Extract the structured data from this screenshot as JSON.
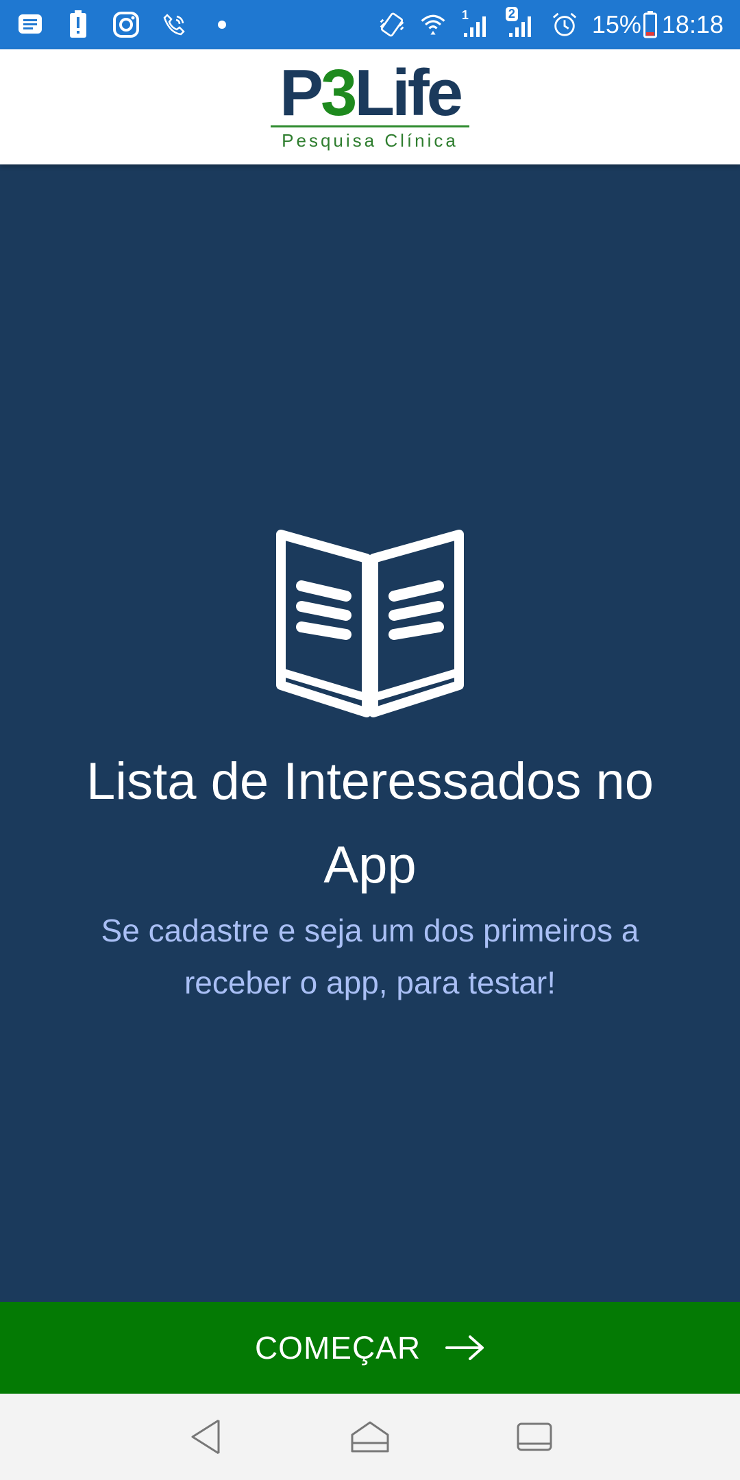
{
  "status_bar": {
    "icons_left": [
      "message-icon",
      "alert-icon",
      "instagram-icon",
      "wifi-call-icon",
      "dot-icon"
    ],
    "icons_right": [
      "vibrate-icon",
      "wifi-icon",
      "signal-1-icon",
      "signal-2-icon",
      "alarm-icon",
      "battery-icon"
    ],
    "sim1_label": "1",
    "sim2_label": "2",
    "battery": "15%",
    "time": "18:18",
    "battery_level": 0.15
  },
  "header": {
    "logo_prefix": "P",
    "logo_accent": "3",
    "logo_suffix": "Life",
    "logo_subtitle": "Pesquisa Clínica"
  },
  "main": {
    "icon": "open-book-icon",
    "title": "Lista de Interessados no App",
    "subtitle": "Se cadastre e seja um dos primeiros a receber o app, para testar!"
  },
  "start_button": {
    "label": "COMEÇAR",
    "icon": "arrow-right-icon"
  },
  "nav_bar": {
    "buttons": [
      "back-icon",
      "home-icon",
      "recents-icon"
    ]
  },
  "colors": {
    "status_bar": "#1f78d1",
    "background": "#1b3a5c",
    "subtitle": "#a9bff5",
    "button": "#047a04",
    "logo_accent": "#1e8a1e"
  }
}
